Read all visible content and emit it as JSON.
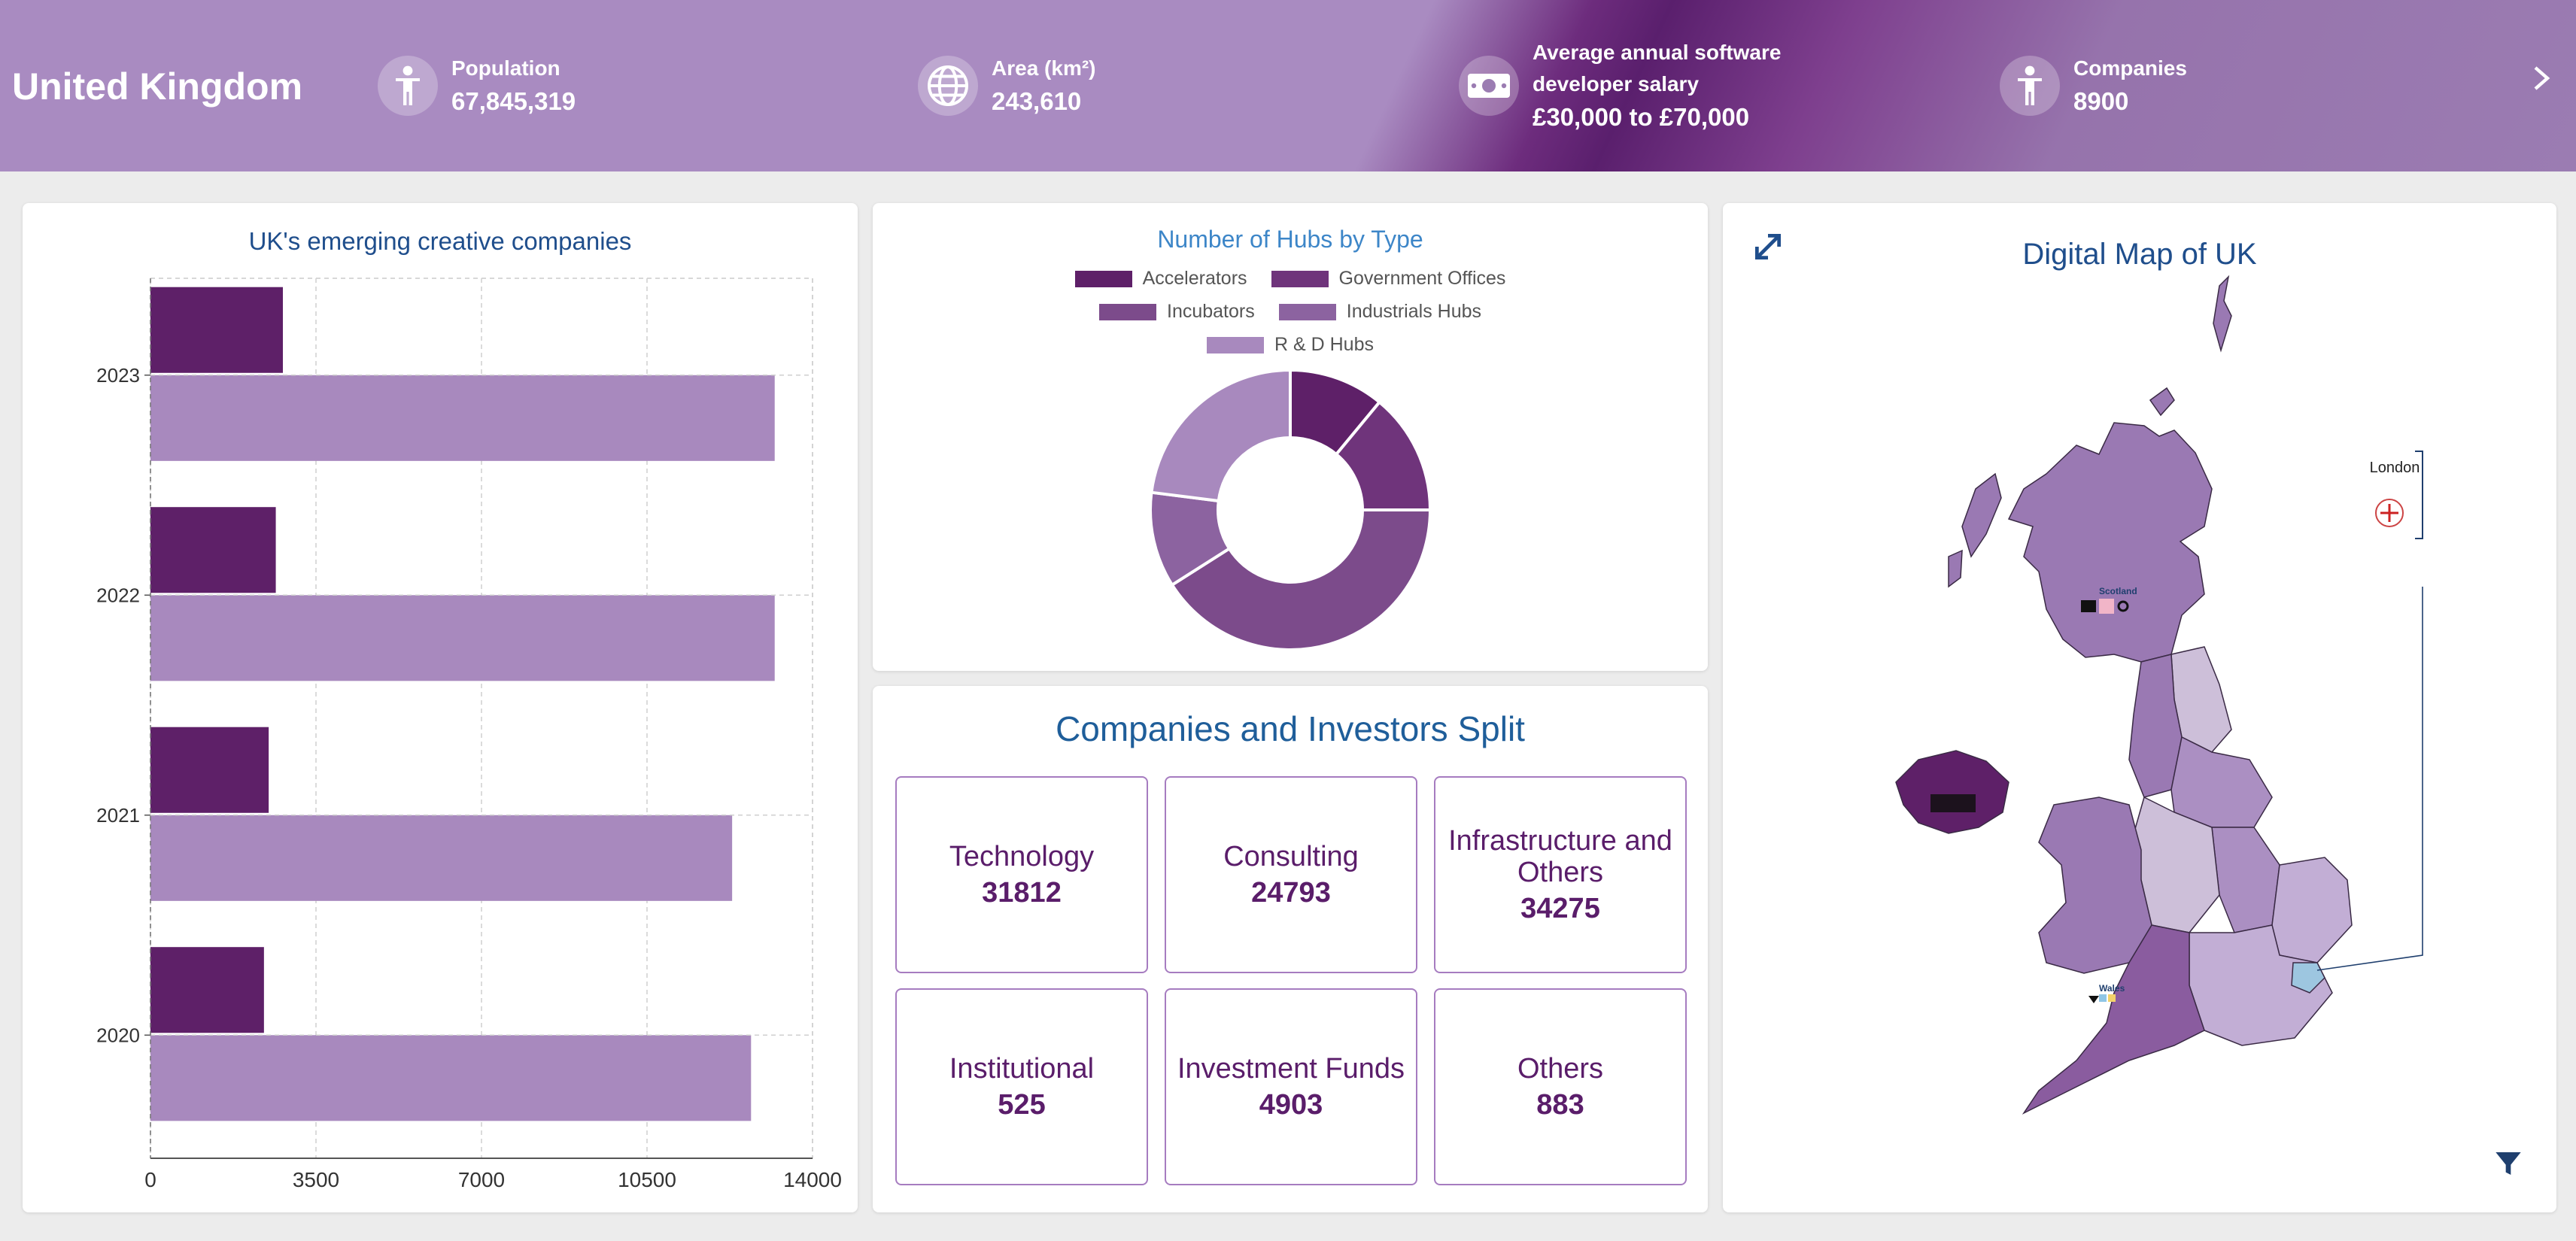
{
  "header": {
    "country": "United Kingdom",
    "kpis": [
      {
        "label": "Population",
        "value": "67,845,319",
        "icon": "person-icon"
      },
      {
        "label": "Area (km²)",
        "value": "243,610",
        "icon": "globe-icon"
      },
      {
        "label": "Average annual software developer salary",
        "label_line1": "Average annual software",
        "label_line2": "developer salary",
        "value": "£30,000 to £70,000",
        "icon": "money-icon"
      },
      {
        "label": "Companies",
        "value": "8900",
        "icon": "person-icon"
      }
    ],
    "next_label": ">"
  },
  "bar_card": {
    "title": "UK's emerging creative companies"
  },
  "donut_card": {
    "title": "Number of Hubs by Type"
  },
  "split_card": {
    "title": "Companies and Investors Split",
    "tiles": [
      {
        "label": "Technology",
        "value": "31812"
      },
      {
        "label": "Consulting",
        "value": "24793"
      },
      {
        "label": "Infrastructure and Others",
        "label_line1": "Infrastructure and",
        "label_line2": "Others",
        "value": "34275"
      },
      {
        "label": "Institutional",
        "value": "525"
      },
      {
        "label": "Investment Funds",
        "value": "4903"
      },
      {
        "label": "Others",
        "value": "883"
      }
    ]
  },
  "map_card": {
    "title": "Digital Map of UK",
    "labels": {
      "scotland": "Scotland",
      "wales": "Wales",
      "london": "London"
    }
  },
  "chart_data": [
    {
      "type": "bar",
      "orientation": "horizontal",
      "title": "UK's emerging creative companies",
      "categories": [
        "2023",
        "2022",
        "2021",
        "2020"
      ],
      "series": [
        {
          "color": "#5e2068",
          "values": [
            2800,
            2650,
            2500,
            2400
          ]
        },
        {
          "color": "#a889be",
          "values": [
            13200,
            13200,
            12300,
            12700
          ]
        }
      ],
      "xlim": [
        0,
        14000
      ],
      "xticks": [
        0,
        3500,
        7000,
        10500,
        14000
      ],
      "grid": true
    },
    {
      "type": "pie",
      "donut": true,
      "title": "Number of Hubs by Type",
      "labels": [
        "Accelerators",
        "Government Offices",
        "Incubators",
        "Industrials Hubs",
        "R & D Hubs"
      ],
      "values": [
        11,
        14,
        41,
        11,
        23
      ],
      "colors": [
        "#5e2068",
        "#6f347b",
        "#7c4b8b",
        "#8c63a0",
        "#a889be"
      ],
      "legend": "top"
    }
  ]
}
